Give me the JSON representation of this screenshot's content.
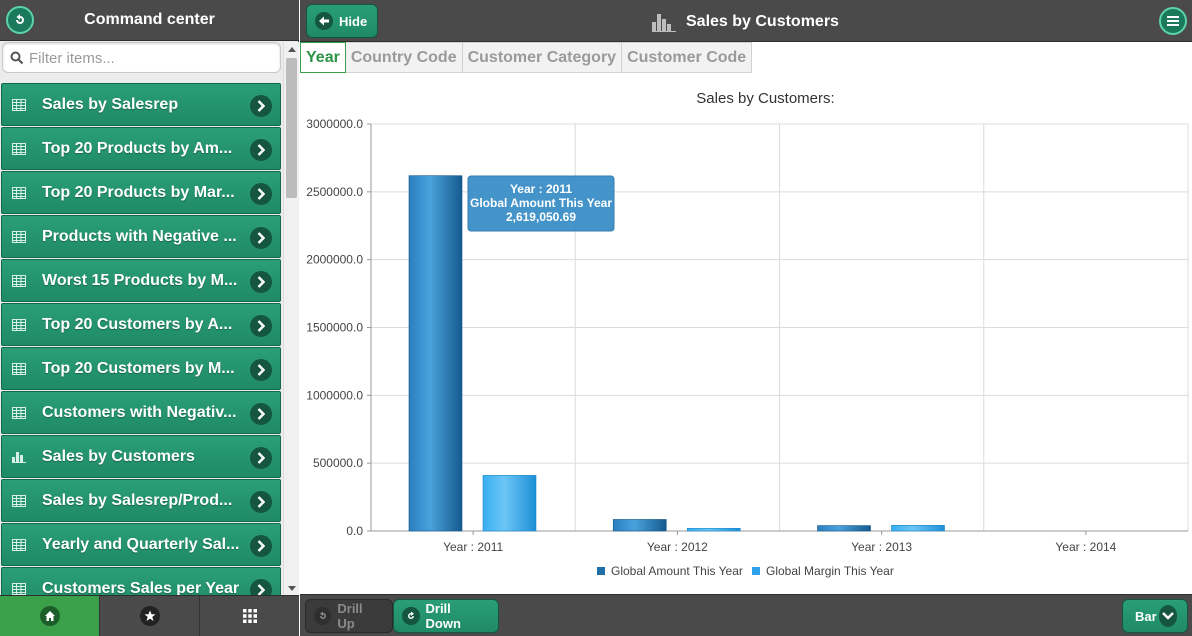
{
  "sidebar": {
    "title": "Command center",
    "filter_placeholder": "Filter items...",
    "items": [
      {
        "label": "Sales by Salesrep",
        "icon": "table-icon"
      },
      {
        "label": "Top 20 Products by Am...",
        "icon": "table-icon"
      },
      {
        "label": "Top 20 Products by Mar...",
        "icon": "table-icon"
      },
      {
        "label": "Products with Negative ...",
        "icon": "table-icon"
      },
      {
        "label": "Worst 15 Products by M...",
        "icon": "table-icon"
      },
      {
        "label": "Top 20 Customers by A...",
        "icon": "table-icon"
      },
      {
        "label": "Top 20 Customers by M...",
        "icon": "table-icon"
      },
      {
        "label": "Customers with Negativ...",
        "icon": "table-icon"
      },
      {
        "label": "Sales by Customers",
        "icon": "bar-chart-icon"
      },
      {
        "label": "Sales by Salesrep/Prod...",
        "icon": "table-icon"
      },
      {
        "label": "Yearly and Quarterly Sal...",
        "icon": "table-icon"
      },
      {
        "label": "Customers Sales per Year",
        "icon": "table-icon"
      }
    ],
    "footer_tabs": [
      {
        "name": "home-icon",
        "active": true
      },
      {
        "name": "star-icon",
        "active": false
      },
      {
        "name": "grid-icon",
        "active": false
      }
    ]
  },
  "header": {
    "hide_label": "Hide",
    "title": "Sales by Customers"
  },
  "tabs": [
    {
      "label": "Year",
      "active": true
    },
    {
      "label": "Country Code",
      "active": false
    },
    {
      "label": "Customer Category",
      "active": false
    },
    {
      "label": "Customer Code",
      "active": false
    }
  ],
  "footer": {
    "drill_up_label": "Drill Up",
    "drill_down_label": "Drill Down",
    "chart_type_label": "Bar"
  },
  "tooltip": {
    "line1": "Year : 2011",
    "line2": "Global Amount This Year",
    "line3": "2,619,050.69"
  },
  "colors": {
    "accent_green": "#1f8a66",
    "series_dark": "#1f6fa8",
    "series_light": "#2ea1e8"
  },
  "chart_data": {
    "type": "bar",
    "title": "Sales by Customers:",
    "categories": [
      "Year : 2011",
      "Year : 2012",
      "Year : 2013",
      "Year : 2014"
    ],
    "series": [
      {
        "name": "Global Amount This Year",
        "values": [
          2619050.69,
          85000,
          40000,
          0
        ]
      },
      {
        "name": "Global Margin This Year",
        "values": [
          410000,
          20000,
          42000,
          0
        ]
      }
    ],
    "ylim": [
      0,
      3000000
    ],
    "yticks": [
      "0.0",
      "500000.0",
      "1000000.0",
      "1500000.0",
      "2000000.0",
      "2500000.0",
      "3000000.0"
    ],
    "grid": true,
    "legend": "bottom"
  }
}
